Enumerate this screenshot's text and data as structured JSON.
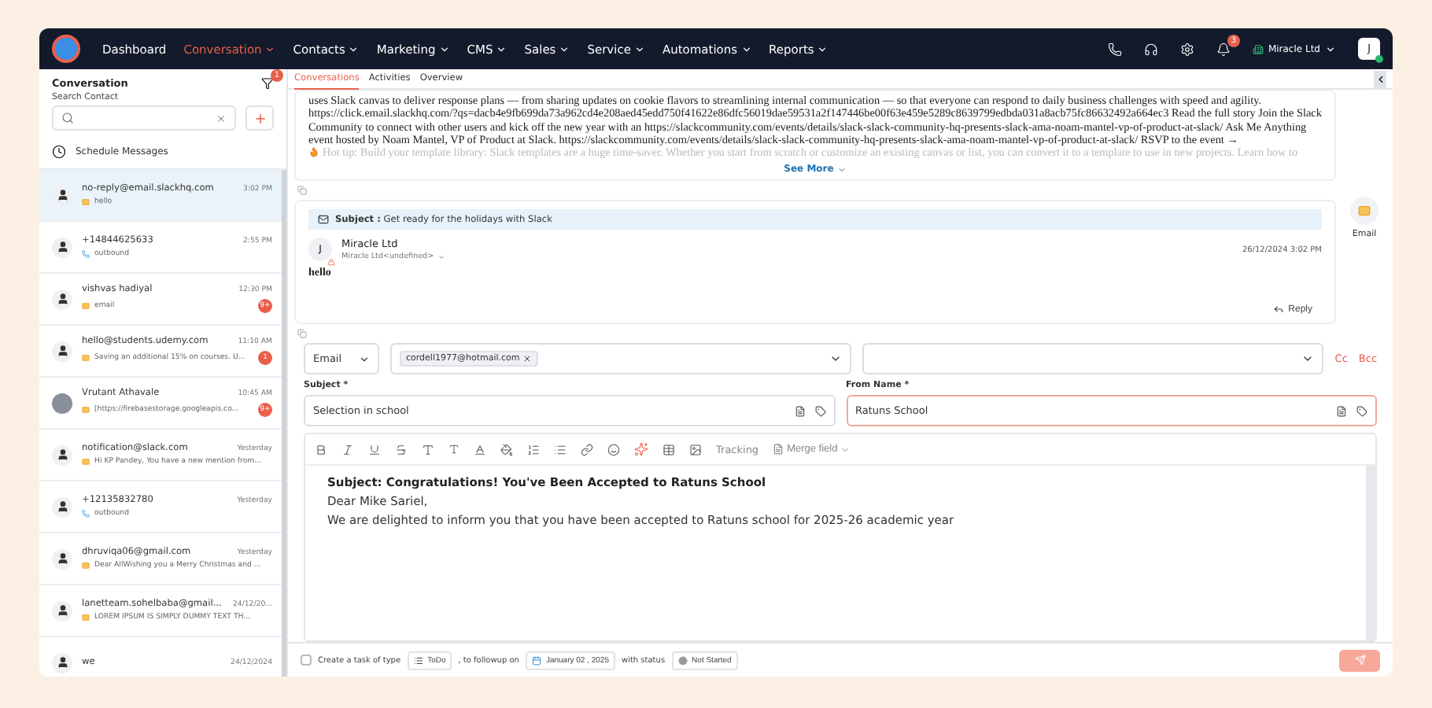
{
  "nav": {
    "items": [
      {
        "label": "Dashboard",
        "selected": false,
        "dropdown": false
      },
      {
        "label": "Conversation",
        "selected": true,
        "dropdown": true
      },
      {
        "label": "Contacts",
        "selected": false,
        "dropdown": true
      },
      {
        "label": "Marketing",
        "selected": false,
        "dropdown": true
      },
      {
        "label": "CMS",
        "selected": false,
        "dropdown": true
      },
      {
        "label": "Sales",
        "selected": false,
        "dropdown": true
      },
      {
        "label": "Service",
        "selected": false,
        "dropdown": true
      },
      {
        "label": "Automations",
        "selected": false,
        "dropdown": true
      },
      {
        "label": "Reports",
        "selected": false,
        "dropdown": true
      }
    ],
    "notifications": "3",
    "account": "Miracle Ltd",
    "avatar": "J"
  },
  "sidebar": {
    "title": "Conversation",
    "filter_badge": "1",
    "search_label": "Search Contact",
    "schedule": "Schedule Messages",
    "contacts": [
      {
        "name": "no-reply@email.slackhq.com",
        "time": "3:02 PM",
        "preview": "hello",
        "kind": "email",
        "photo": false,
        "selected": true
      },
      {
        "name": "+14844625633",
        "time": "2:55 PM",
        "preview": "outbound",
        "kind": "call",
        "photo": false,
        "selected": false
      },
      {
        "name": "vishvas hadiyal",
        "time": "12:30 PM",
        "preview": "email",
        "kind": "email",
        "photo": false,
        "badge": "9+",
        "selected": false
      },
      {
        "name": "hello@students.udemy.com",
        "time": "11:10 AM",
        "preview": "Saving an additional 15% on courses. U...",
        "kind": "email",
        "photo": false,
        "badge": "1",
        "selected": false
      },
      {
        "name": "Vrutant Athavale",
        "time": "10:45 AM",
        "preview": "[https://firebasestorage.googleapis.co...",
        "kind": "email",
        "photo": true,
        "badge": "9+",
        "selected": false
      },
      {
        "name": "notification@slack.com",
        "time": "Yesterday",
        "preview": "Hi KP Pandey, You have a new mention from...",
        "kind": "email",
        "photo": false,
        "selected": false
      },
      {
        "name": "+12135832780",
        "time": "Yesterday",
        "preview": "outbound",
        "kind": "call",
        "photo": false,
        "selected": false
      },
      {
        "name": "dhruviqa06@gmail.com",
        "time": "Yesterday",
        "preview": "Dear AllWishing you a Merry Christmas and ...",
        "kind": "email",
        "photo": false,
        "selected": false
      },
      {
        "name": "lanetteam.sohelbaba@gmail...",
        "time": "24/12/20...",
        "preview": "LOREM IPSUM IS SIMPLY DUMMY TEXT TH...",
        "kind": "email",
        "photo": false,
        "selected": false
      },
      {
        "name": "we",
        "time": "24/12/2024",
        "photo": false,
        "selected": false
      }
    ]
  },
  "tabs": [
    {
      "label": "Conversations",
      "selected": true
    },
    {
      "label": "Activities",
      "selected": false
    },
    {
      "label": "Overview",
      "selected": false
    }
  ],
  "message_1": {
    "body": "uses Slack canvas to deliver response plans — from sharing updates on cookie flavors to streamlining internal communication — so that everyone can respond to daily business challenges with speed and agility. https://click.email.slackhq.com/?qs=dacb4e9fb699da73a962cd4e208aed45edd750f41622e86dfc56019dae59531a2f147446be00f63e459e5289c8639799edbda031a8acb75fc86632492a664ec3 Read the full story Join the Slack Community to connect with other users and kick off the new year with an https://slackcommunity.com/events/details/slack-slack-community-hq-presents-slack-ama-noam-mantel-vp-of-product-at-slack/ Ask Me Anything event hosted by Noam Mantel, VP of Product at Slack. https://slackcommunity.com/events/details/slack-slack-community-hq-presents-slack-ama-noam-mantel-vp-of-product-at-slack/ RSVP to the event →",
    "body_faded": "Hot tip: Build your template library: Slack templates are a huge time-saver. Whether you start from scratch or customize an existing canvas or list, you can convert it to a template to use in new projects. Learn how to",
    "see_more": "See More"
  },
  "message_2": {
    "subject_label": "Subject :",
    "subject": "Get ready for the holidays with Slack",
    "sender_initial": "J",
    "sender": "Miracle Ltd",
    "sender_address": "Miracle Ltd<undefined>",
    "date": "26/12/2024 3:02 PM",
    "body": "hello",
    "reply": "Reply"
  },
  "channel": {
    "label": "Email"
  },
  "compose": {
    "channel": "Email",
    "recipient": "cordell1977@hotmail.com",
    "cc": "Cc",
    "bcc": "Bcc",
    "subject_label": "Subject *",
    "subject": "Selection in school",
    "from_label": "From Name *",
    "from_name": "Ratuns School",
    "tracking": "Tracking",
    "merge_field": "Merge field",
    "content_title": "Subject: Congratulations! You've Been Accepted to Ratuns School",
    "greeting": "Dear Mike Sariel,",
    "content_body": "We are delighted to inform you that you have been accepted to Ratuns school for 2025-26 academic year",
    "footer": {
      "task_checked": false,
      "task_label": "Create a task of type",
      "task_type": "ToDo",
      "followup": ", to followup on",
      "date": "January 02 , 2025",
      "status_label": "with status",
      "status": "Not Started"
    }
  }
}
